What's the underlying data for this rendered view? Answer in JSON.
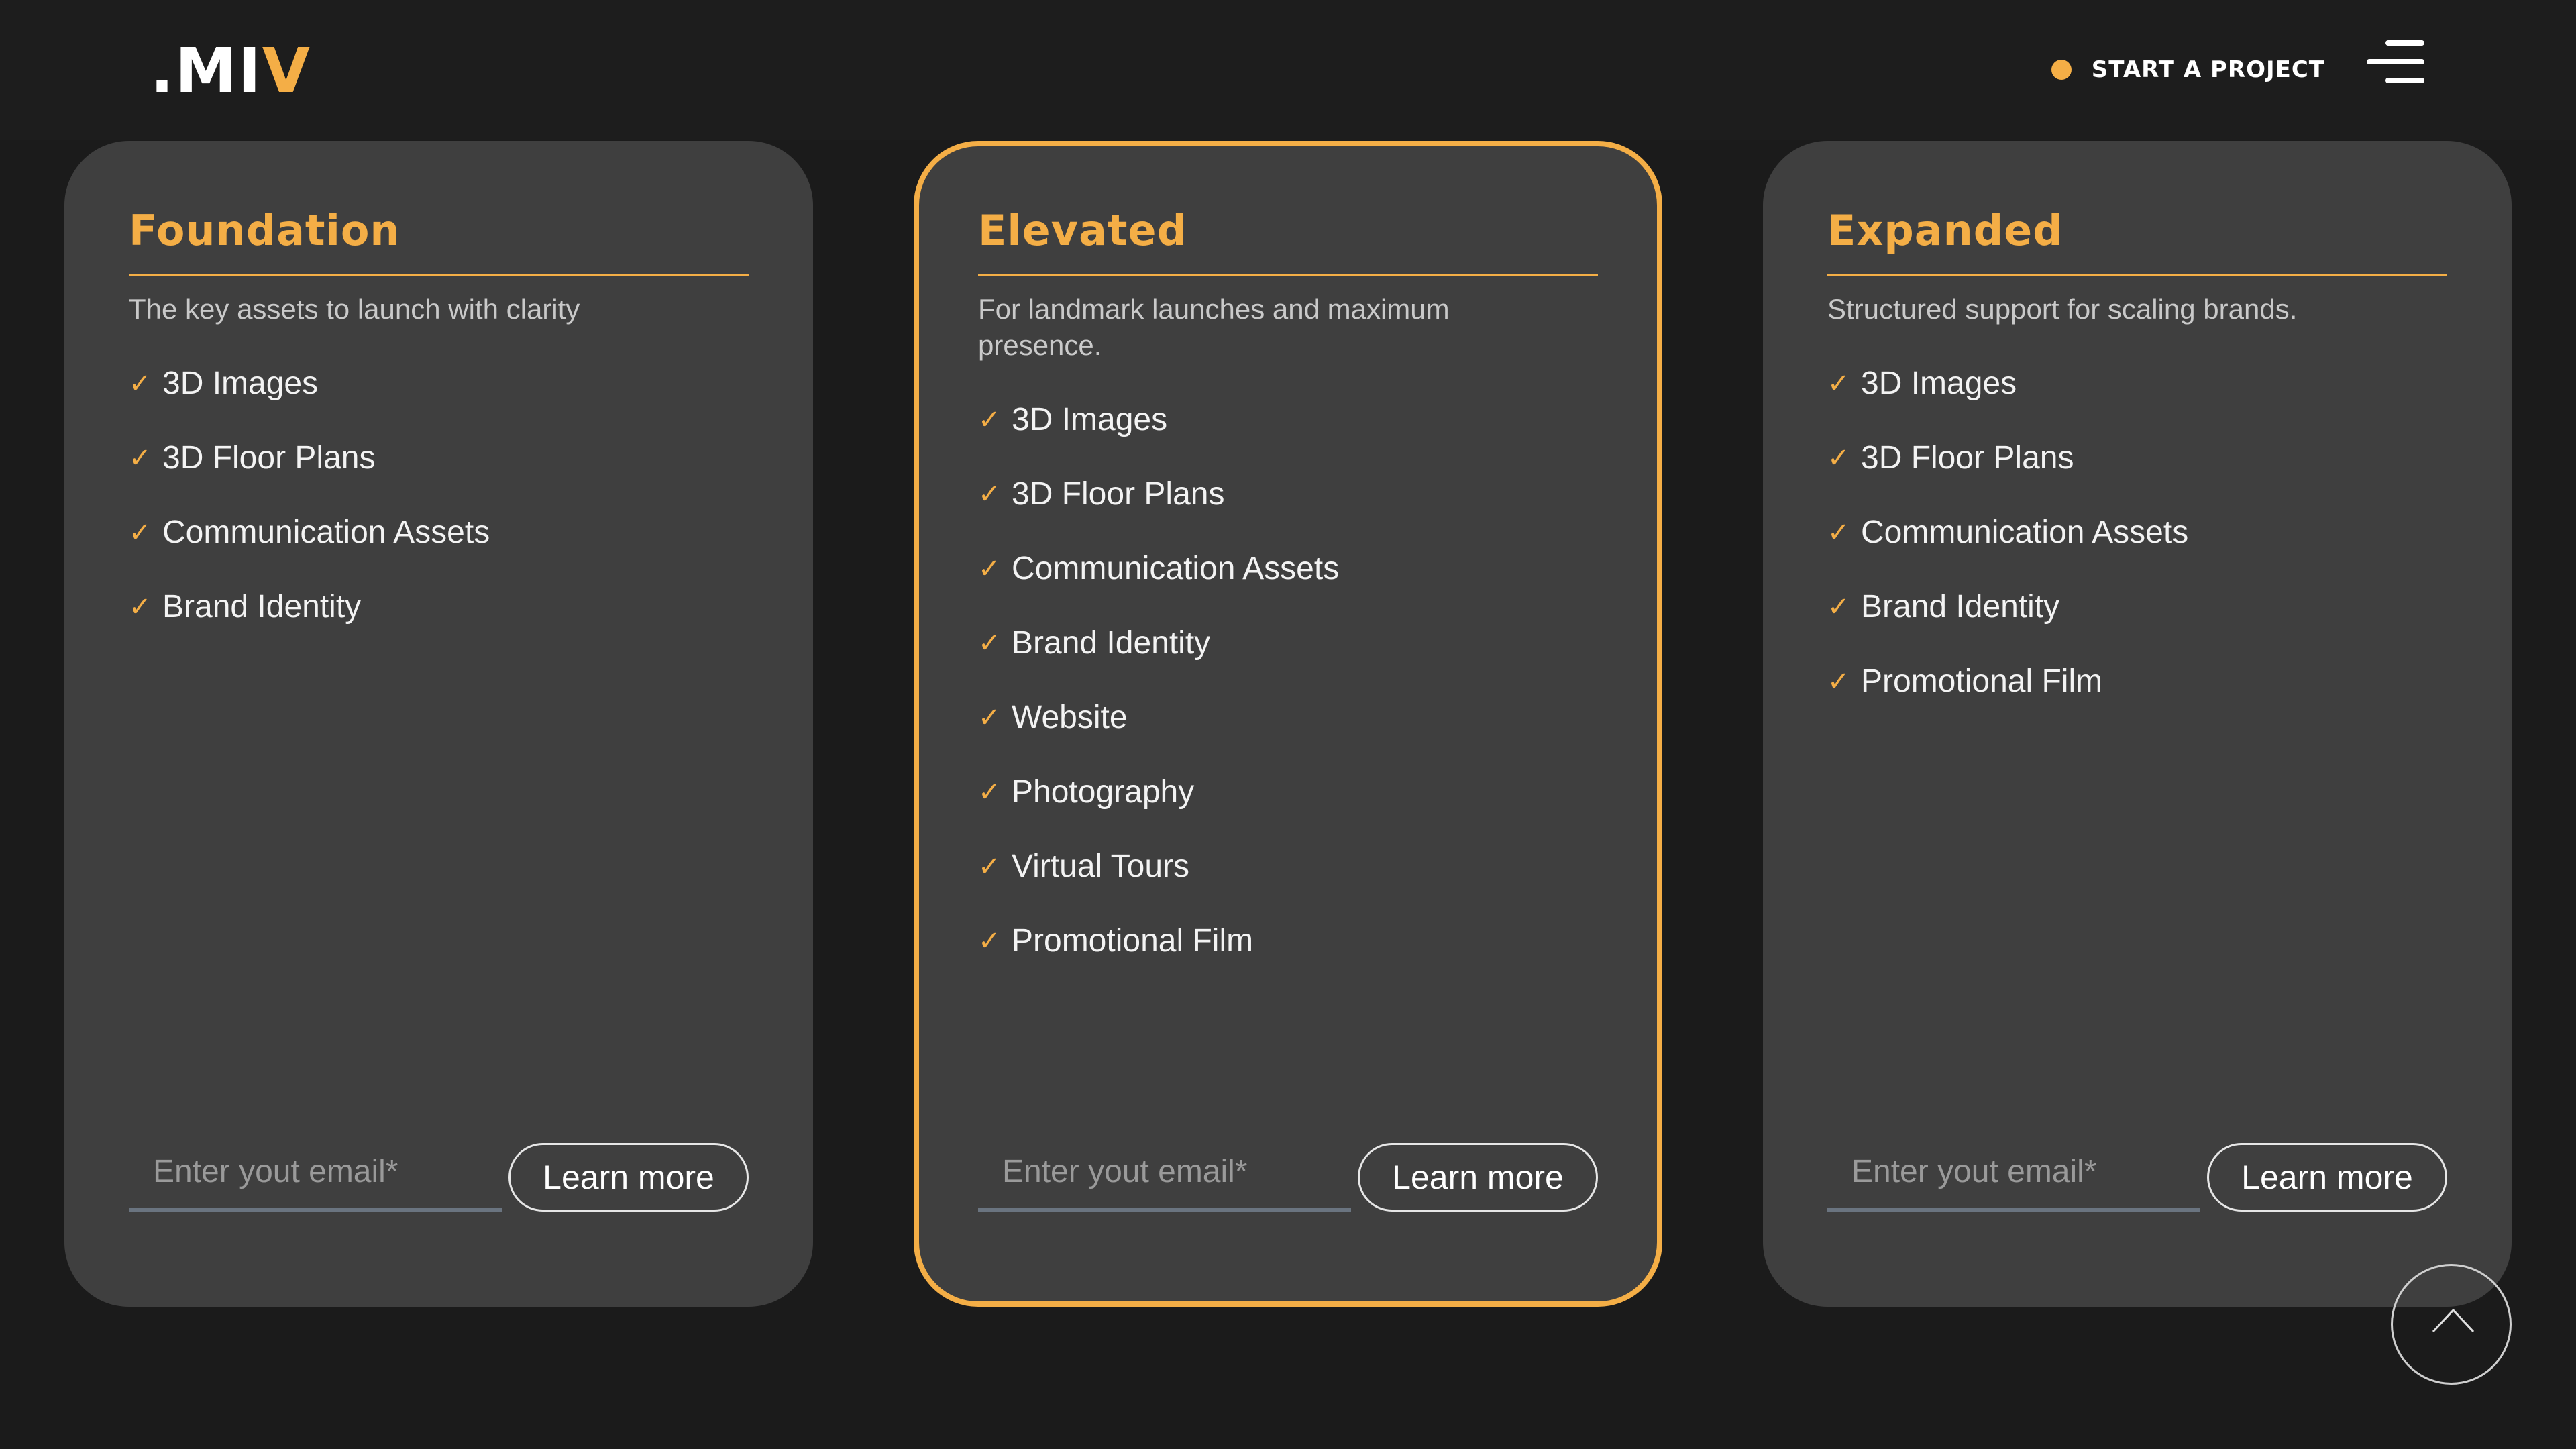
{
  "header": {
    "logo_dot_mi": ".MI",
    "logo_v": "V",
    "cta_label": "START A PROJECT",
    "menu_icon": "hamburger-menu-icon"
  },
  "colors": {
    "accent": "#f4ae46",
    "background": "#1b1b1b",
    "card": "#3f3f3f"
  },
  "plans": [
    {
      "title": "Foundation",
      "subtitle": "The key assets to launch with clarity",
      "features": [
        "3D Images",
        "3D Floor Plans",
        "Communication Assets",
        "Brand Identity"
      ],
      "email_placeholder": "Enter yout email*",
      "button_label": "Learn more",
      "highlighted": false
    },
    {
      "title": "Elevated",
      "subtitle": "For landmark launches and maximum presence.",
      "features": [
        "3D Images",
        "3D Floor Plans",
        "Communication Assets",
        "Brand Identity",
        "Website",
        "Photography",
        "Virtual Tours",
        "Promotional Film"
      ],
      "email_placeholder": "Enter yout email*",
      "button_label": "Learn more",
      "highlighted": true
    },
    {
      "title": "Expanded",
      "subtitle": "Structured support for scaling brands.",
      "features": [
        "3D Images",
        "3D Floor Plans",
        "Communication Assets",
        "Brand Identity",
        "Promotional Film"
      ],
      "email_placeholder": "Enter yout email*",
      "button_label": "Learn more",
      "highlighted": false
    }
  ],
  "check_glyph": "✓",
  "back_to_top_icon": "chevron-up-icon"
}
